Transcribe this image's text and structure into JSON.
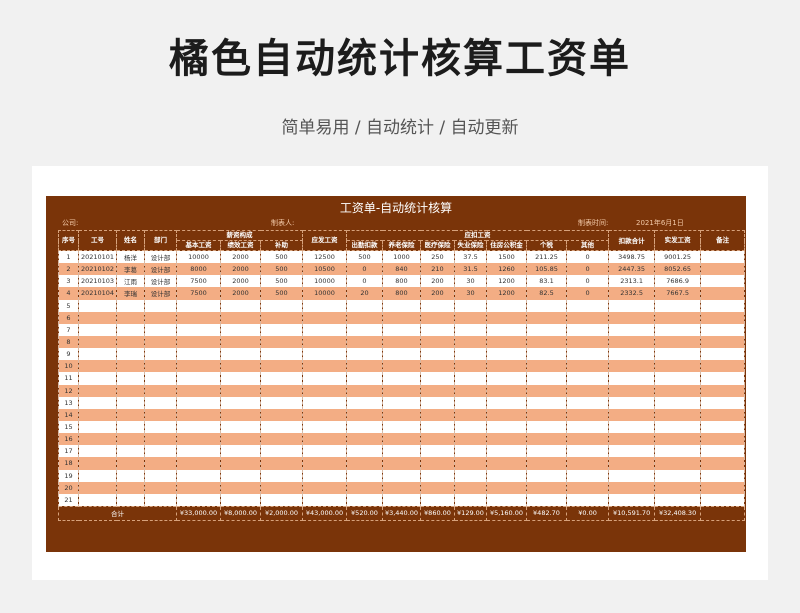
{
  "page": {
    "title": "橘色自动统计核算工资单",
    "subtitle": "简单易用 / 自动统计 / 自动更新"
  },
  "sheet": {
    "title": "工资单-自动统计核算",
    "company_label": "公司:",
    "maker_label": "制表人:",
    "date_label": "制表时间:",
    "date_value": "2021年6月1日"
  },
  "headers": {
    "groups": {
      "salary": "薪资构成",
      "deduct": "应扣工资"
    },
    "seq": "序号",
    "emp_no": "工号",
    "name": "姓名",
    "dept": "部门",
    "base": "基本工资",
    "perf": "绩效工资",
    "subsidy": "补助",
    "payable": "应发工资",
    "absence": "出勤扣款",
    "pension": "养老保险",
    "medical": "医疗保险",
    "unemployment": "失业保险",
    "housing": "住房公积金",
    "tax": "个税",
    "other": "其他",
    "deduct_total": "扣款合计",
    "actual": "实发工资",
    "remark": "备注"
  },
  "rows": [
    [
      "1",
      "20210101",
      "杨洋",
      "设计部",
      "10000",
      "2000",
      "500",
      "12500",
      "500",
      "1000",
      "250",
      "37.5",
      "1500",
      "211.25",
      "0",
      "3498.75",
      "9001.25",
      ""
    ],
    [
      "2",
      "20210102",
      "李葛",
      "设计部",
      "8000",
      "2000",
      "500",
      "10500",
      "0",
      "840",
      "210",
      "31.5",
      "1260",
      "105.85",
      "0",
      "2447.35",
      "8052.65",
      ""
    ],
    [
      "3",
      "20210103",
      "江雨",
      "设计部",
      "7500",
      "2000",
      "500",
      "10000",
      "0",
      "800",
      "200",
      "30",
      "1200",
      "83.1",
      "0",
      "2313.1",
      "7686.9",
      ""
    ],
    [
      "4",
      "20210104",
      "李瑞",
      "设计部",
      "7500",
      "2000",
      "500",
      "10000",
      "20",
      "800",
      "200",
      "30",
      "1200",
      "82.5",
      "0",
      "2332.5",
      "7667.5",
      ""
    ],
    [
      "5",
      "",
      "",
      "",
      "",
      "",
      "",
      "",
      "",
      "",
      "",
      "",
      "",
      "",
      "",
      "",
      "",
      ""
    ],
    [
      "6",
      "",
      "",
      "",
      "",
      "",
      "",
      "",
      "",
      "",
      "",
      "",
      "",
      "",
      "",
      "",
      "",
      ""
    ],
    [
      "7",
      "",
      "",
      "",
      "",
      "",
      "",
      "",
      "",
      "",
      "",
      "",
      "",
      "",
      "",
      "",
      "",
      ""
    ],
    [
      "8",
      "",
      "",
      "",
      "",
      "",
      "",
      "",
      "",
      "",
      "",
      "",
      "",
      "",
      "",
      "",
      "",
      ""
    ],
    [
      "9",
      "",
      "",
      "",
      "",
      "",
      "",
      "",
      "",
      "",
      "",
      "",
      "",
      "",
      "",
      "",
      "",
      ""
    ],
    [
      "10",
      "",
      "",
      "",
      "",
      "",
      "",
      "",
      "",
      "",
      "",
      "",
      "",
      "",
      "",
      "",
      "",
      ""
    ],
    [
      "11",
      "",
      "",
      "",
      "",
      "",
      "",
      "",
      "",
      "",
      "",
      "",
      "",
      "",
      "",
      "",
      "",
      ""
    ],
    [
      "12",
      "",
      "",
      "",
      "",
      "",
      "",
      "",
      "",
      "",
      "",
      "",
      "",
      "",
      "",
      "",
      "",
      ""
    ],
    [
      "13",
      "",
      "",
      "",
      "",
      "",
      "",
      "",
      "",
      "",
      "",
      "",
      "",
      "",
      "",
      "",
      "",
      ""
    ],
    [
      "14",
      "",
      "",
      "",
      "",
      "",
      "",
      "",
      "",
      "",
      "",
      "",
      "",
      "",
      "",
      "",
      "",
      ""
    ],
    [
      "15",
      "",
      "",
      "",
      "",
      "",
      "",
      "",
      "",
      "",
      "",
      "",
      "",
      "",
      "",
      "",
      "",
      ""
    ],
    [
      "16",
      "",
      "",
      "",
      "",
      "",
      "",
      "",
      "",
      "",
      "",
      "",
      "",
      "",
      "",
      "",
      "",
      ""
    ],
    [
      "17",
      "",
      "",
      "",
      "",
      "",
      "",
      "",
      "",
      "",
      "",
      "",
      "",
      "",
      "",
      "",
      "",
      ""
    ],
    [
      "18",
      "",
      "",
      "",
      "",
      "",
      "",
      "",
      "",
      "",
      "",
      "",
      "",
      "",
      "",
      "",
      "",
      ""
    ],
    [
      "19",
      "",
      "",
      "",
      "",
      "",
      "",
      "",
      "",
      "",
      "",
      "",
      "",
      "",
      "",
      "",
      "",
      ""
    ],
    [
      "20",
      "",
      "",
      "",
      "",
      "",
      "",
      "",
      "",
      "",
      "",
      "",
      "",
      "",
      "",
      "",
      "",
      ""
    ],
    [
      "21",
      "",
      "",
      "",
      "",
      "",
      "",
      "",
      "",
      "",
      "",
      "",
      "",
      "",
      "",
      "",
      "",
      ""
    ]
  ],
  "totals": {
    "label": "合计",
    "base": "¥33,000.00",
    "perf": "¥8,000.00",
    "subsidy": "¥2,000.00",
    "payable": "¥43,000.00",
    "absence": "¥520.00",
    "pension": "¥3,440.00",
    "medical": "¥860.00",
    "unemployment": "¥129.00",
    "housing": "¥5,160.00",
    "tax": "¥482.70",
    "other": "¥0.00",
    "deduct_total": "¥10,591.70",
    "actual": "¥32,408.30"
  },
  "colors": {
    "header_bg": "#7a3409",
    "stripe_orange": "#f3ad84",
    "stripe_white": "#ffffff"
  }
}
